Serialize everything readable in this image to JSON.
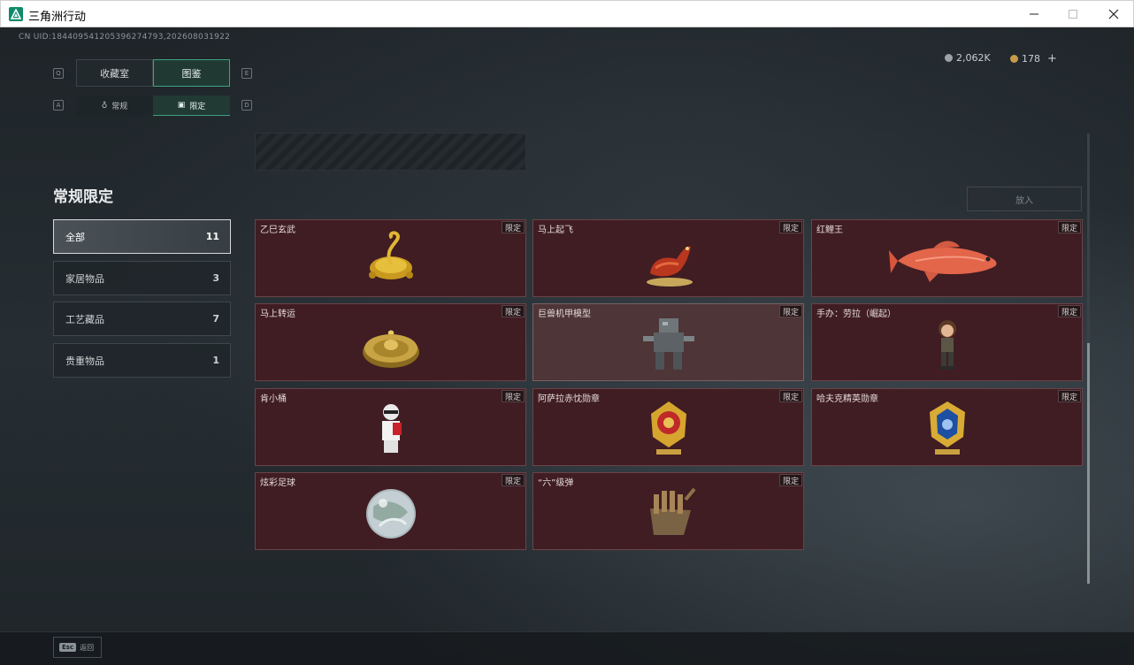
{
  "window": {
    "title": "三角洲行动"
  },
  "header": {
    "uid": "CN UID:18440954120539627479​3,202608031922",
    "currency_1": "2,062K",
    "currency_2": "178",
    "plus": "+",
    "key_left": "Q",
    "key_right": "E",
    "key_sub_left": "A",
    "key_sub_right": "D"
  },
  "tabs": [
    {
      "label": "收藏室"
    },
    {
      "label": "图鉴"
    }
  ],
  "subtabs": [
    {
      "label": "常规"
    },
    {
      "label": "限定"
    }
  ],
  "section_title": "常规限定",
  "categories": [
    {
      "label": "全部",
      "count": "11"
    },
    {
      "label": "家居物品",
      "count": "3"
    },
    {
      "label": "工艺藏品",
      "count": "7"
    },
    {
      "label": "贵重物品",
      "count": "1"
    }
  ],
  "put_button": "放入",
  "badge_label": "限定",
  "items": [
    {
      "name": "乙巳玄武",
      "icon": "gold-turtle-snake"
    },
    {
      "name": "马上起飞",
      "icon": "red-horse"
    },
    {
      "name": "红鲤王",
      "icon": "red-carp"
    },
    {
      "name": "马上转运",
      "icon": "gold-disc"
    },
    {
      "name": "巨兽机甲模型",
      "icon": "mech-model"
    },
    {
      "name": "手办：劳拉（崛起）",
      "icon": "figure-lara"
    },
    {
      "name": "肯小桶",
      "icon": "bucket-figure"
    },
    {
      "name": "阿萨拉赤忱勋章",
      "icon": "red-medal"
    },
    {
      "name": "哈夫克精英勋章",
      "icon": "blue-medal"
    },
    {
      "name": "炫彩足球",
      "icon": "iridescent-ball"
    },
    {
      "name": "“六”级弹",
      "icon": "bullet-hand"
    }
  ],
  "bottom": {
    "esc_key": "Esc",
    "esc_label": "返回"
  },
  "colors": {
    "accent": "#3fa184",
    "card_bg": "#3f1d23"
  }
}
